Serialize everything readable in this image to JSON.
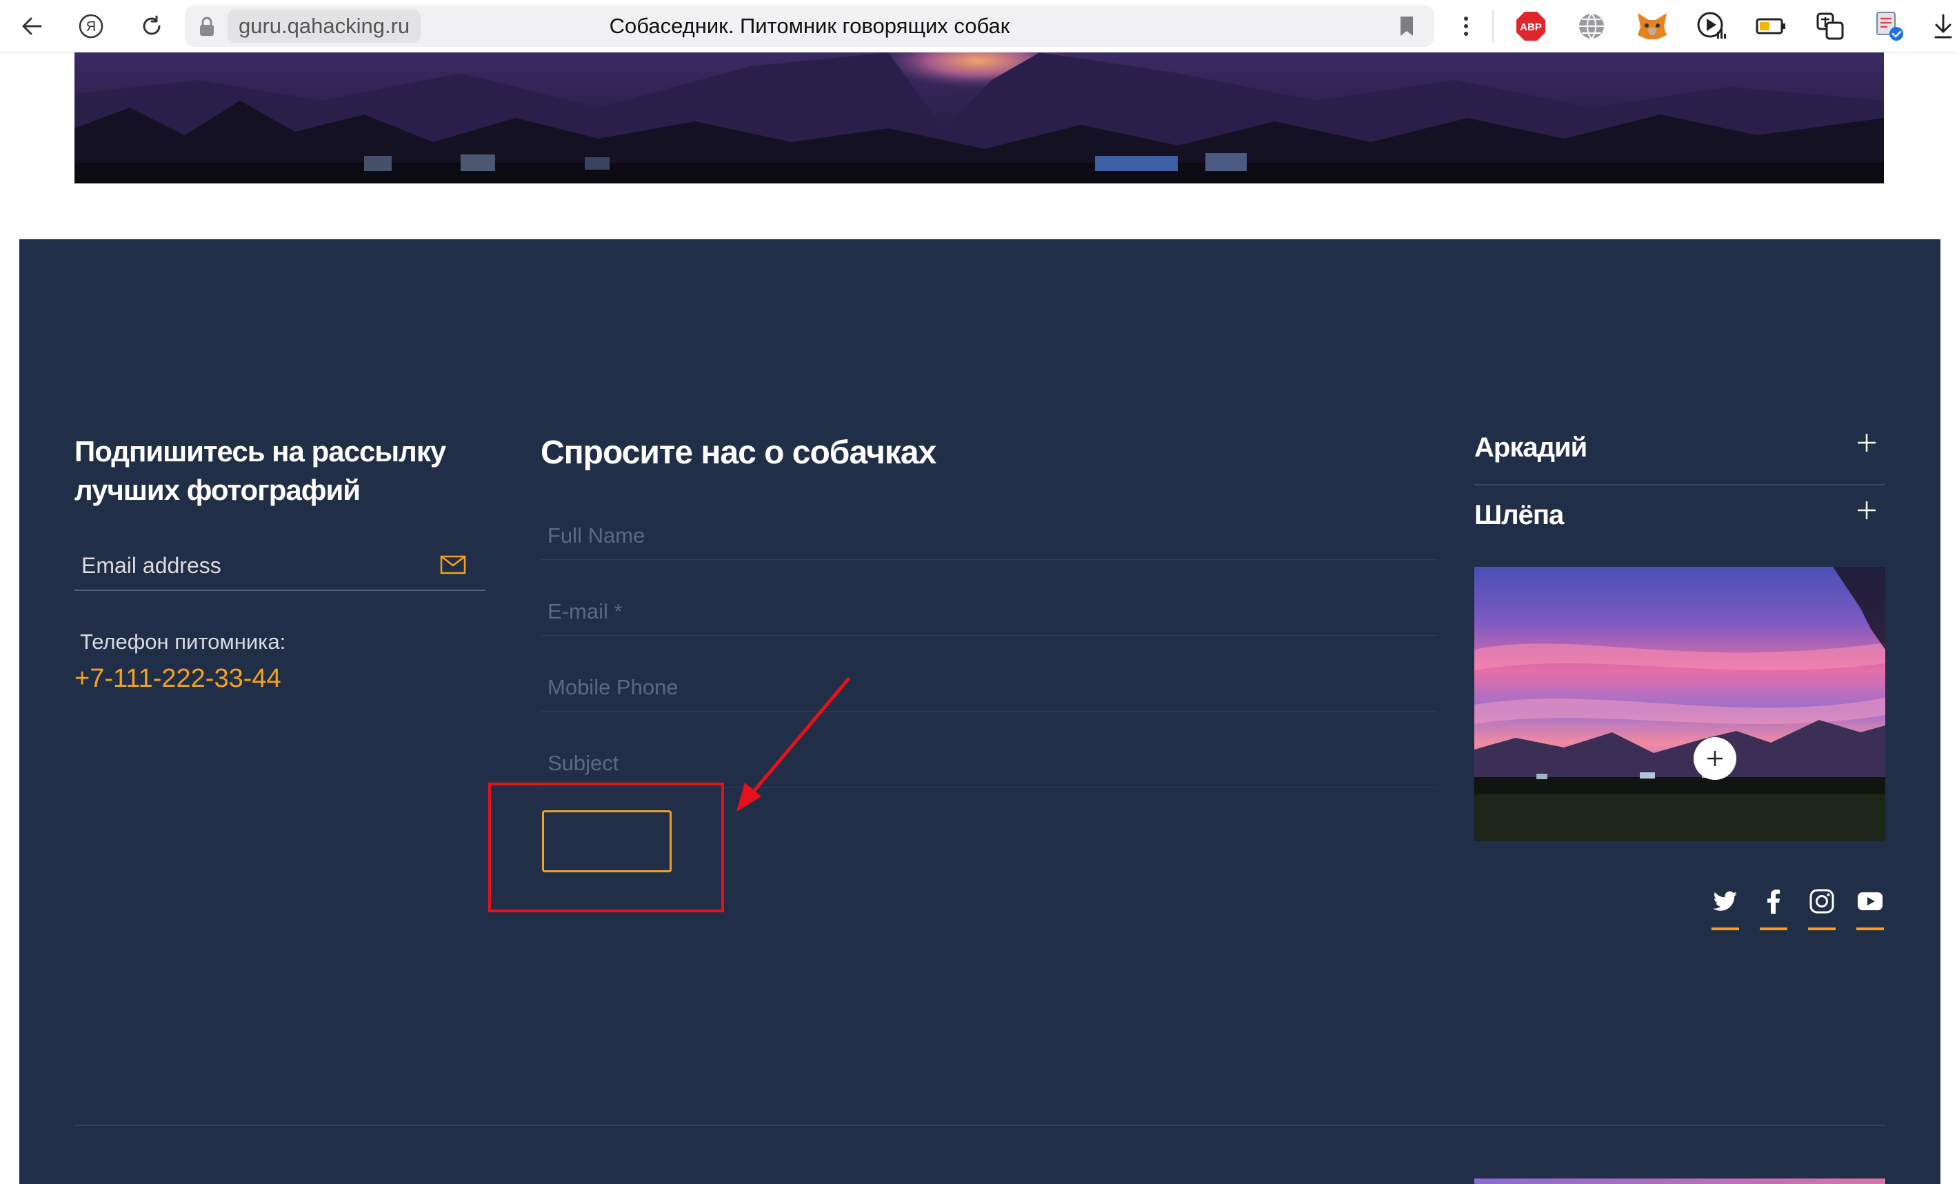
{
  "browser": {
    "url": "guru.qahacking.ru",
    "title": "Собаседник. Питомник говорящих собак",
    "extensions": [
      "adblock-icon",
      "globe-icon",
      "metamask-icon",
      "screen-recorder-icon",
      "battery-icon",
      "translate-icon",
      "document-check-icon"
    ],
    "abp_label": "ABP"
  },
  "subscribe": {
    "heading": "Подпишитесь на рассылку лучших фотографий",
    "email_placeholder": "Email address",
    "phone_label": "Телефон питомника:",
    "phone_number": "+7-111-222-33-44"
  },
  "contact_form": {
    "heading": "Спросите нас о собачках",
    "fields": [
      {
        "placeholder": "Full Name"
      },
      {
        "placeholder": "E-mail *"
      },
      {
        "placeholder": "Mobile Phone"
      },
      {
        "placeholder": "Subject"
      }
    ],
    "submit_label": ""
  },
  "accordion": [
    {
      "label": "Аркадий"
    },
    {
      "label": "Шлёпа"
    }
  ],
  "social": [
    "twitter-icon",
    "facebook-icon",
    "instagram-icon",
    "youtube-icon"
  ],
  "colors": {
    "footer_bg": "#212e47",
    "accent": "#f7a21b",
    "highlight": "#e8101a"
  }
}
